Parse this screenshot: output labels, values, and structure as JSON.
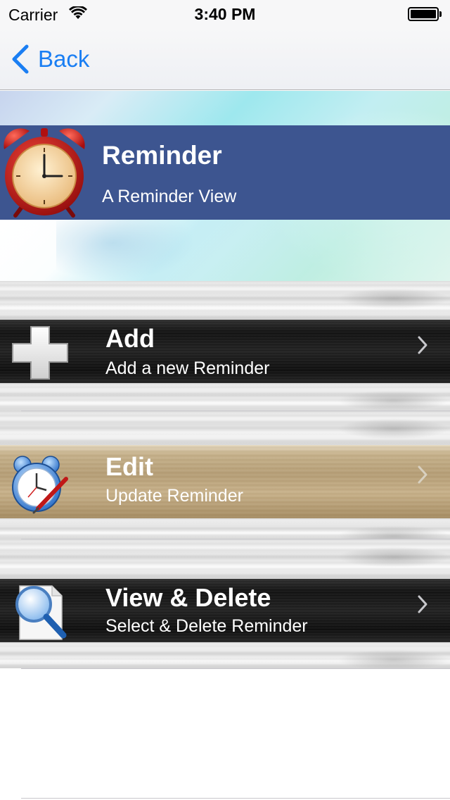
{
  "status_bar": {
    "carrier": "Carrier",
    "time": "3:40 PM",
    "wifi_icon": "wifi-icon",
    "battery_icon": "battery-icon"
  },
  "nav": {
    "back_label": "Back",
    "back_icon": "chevron-left-icon"
  },
  "header": {
    "title": "Reminder",
    "subtitle": "A Reminder View",
    "icon": "alarm-clock-icon"
  },
  "menu": {
    "items": [
      {
        "title": "Add",
        "subtitle": "Add a new Reminder",
        "icon": "plus-icon"
      },
      {
        "title": "Edit",
        "subtitle": "Update Reminder",
        "icon": "alarm-clock-pen-icon"
      },
      {
        "title": "View & Delete",
        "subtitle": "Select & Delete Reminder",
        "icon": "magnifier-document-icon"
      }
    ]
  },
  "colors": {
    "accent": "#1a7ef3",
    "header_band": "#3d5590",
    "text_on_band": "#ffffff"
  }
}
